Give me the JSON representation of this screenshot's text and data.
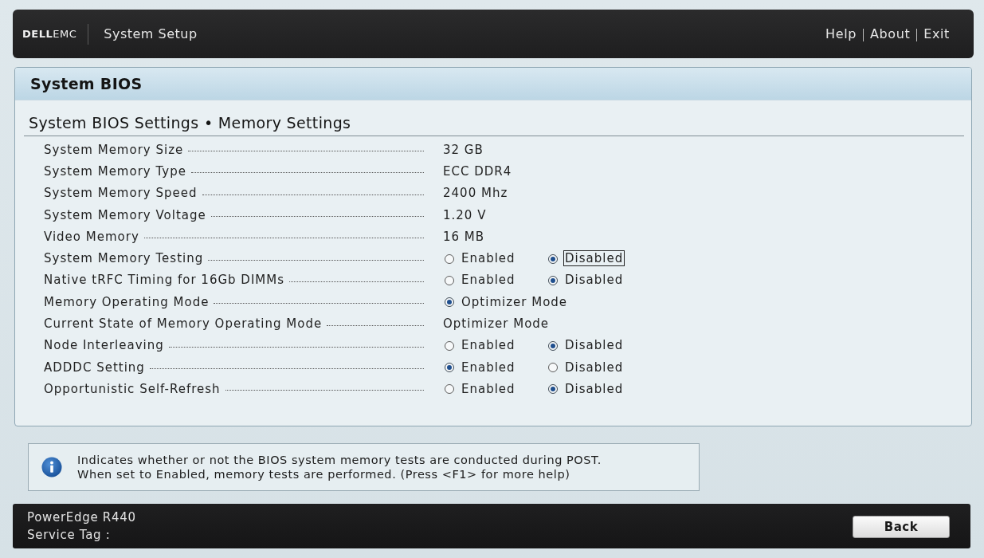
{
  "header": {
    "logo": "**DELL**EMC",
    "title": "System Setup",
    "links": [
      "Help",
      "About",
      "Exit"
    ]
  },
  "panel": {
    "title": "System BIOS",
    "subtitle": "System BIOS Settings • Memory Settings",
    "rows": [
      {
        "kind": "value",
        "label": "System Memory Size",
        "value": "32 GB"
      },
      {
        "kind": "value",
        "label": "System Memory Type",
        "value": "ECC DDR4"
      },
      {
        "kind": "value",
        "label": "System Memory Speed",
        "value": "2400 Mhz"
      },
      {
        "kind": "value",
        "label": "System Memory Voltage",
        "value": "1.20 V"
      },
      {
        "kind": "value",
        "label": "Video Memory",
        "value": "16 MB"
      },
      {
        "kind": "radio",
        "label": "System Memory Testing",
        "options": [
          {
            "label": "Enabled",
            "selected": false,
            "focused": false
          },
          {
            "label": "Disabled",
            "selected": true,
            "focused": true
          }
        ]
      },
      {
        "kind": "radio",
        "label": "Native tRFC Timing for 16Gb DIMMs",
        "options": [
          {
            "label": "Enabled",
            "selected": false,
            "focused": false
          },
          {
            "label": "Disabled",
            "selected": true,
            "focused": false
          }
        ]
      },
      {
        "kind": "radio",
        "label": "Memory Operating Mode",
        "options": [
          {
            "label": "Optimizer Mode",
            "selected": true,
            "focused": false
          }
        ]
      },
      {
        "kind": "value",
        "label": "Current State of Memory Operating Mode",
        "value": "Optimizer Mode"
      },
      {
        "kind": "radio",
        "label": "Node Interleaving",
        "options": [
          {
            "label": "Enabled",
            "selected": false,
            "focused": false
          },
          {
            "label": "Disabled",
            "selected": true,
            "focused": false
          }
        ]
      },
      {
        "kind": "radio",
        "label": "ADDDC Setting",
        "options": [
          {
            "label": "Enabled",
            "selected": true,
            "focused": false
          },
          {
            "label": "Disabled",
            "selected": false,
            "focused": false
          }
        ]
      },
      {
        "kind": "radio",
        "label": "Opportunistic Self-Refresh",
        "options": [
          {
            "label": "Enabled",
            "selected": false,
            "focused": false
          },
          {
            "label": "Disabled",
            "selected": true,
            "focused": false
          }
        ]
      }
    ]
  },
  "help": {
    "lines": [
      "Indicates whether or not the BIOS system memory tests are conducted during POST.",
      "When set to Enabled, memory tests are performed. (Press <F1> for more help)"
    ]
  },
  "footer": {
    "model": "PowerEdge R440",
    "service_tag_label": "Service Tag :",
    "button": "Back"
  }
}
